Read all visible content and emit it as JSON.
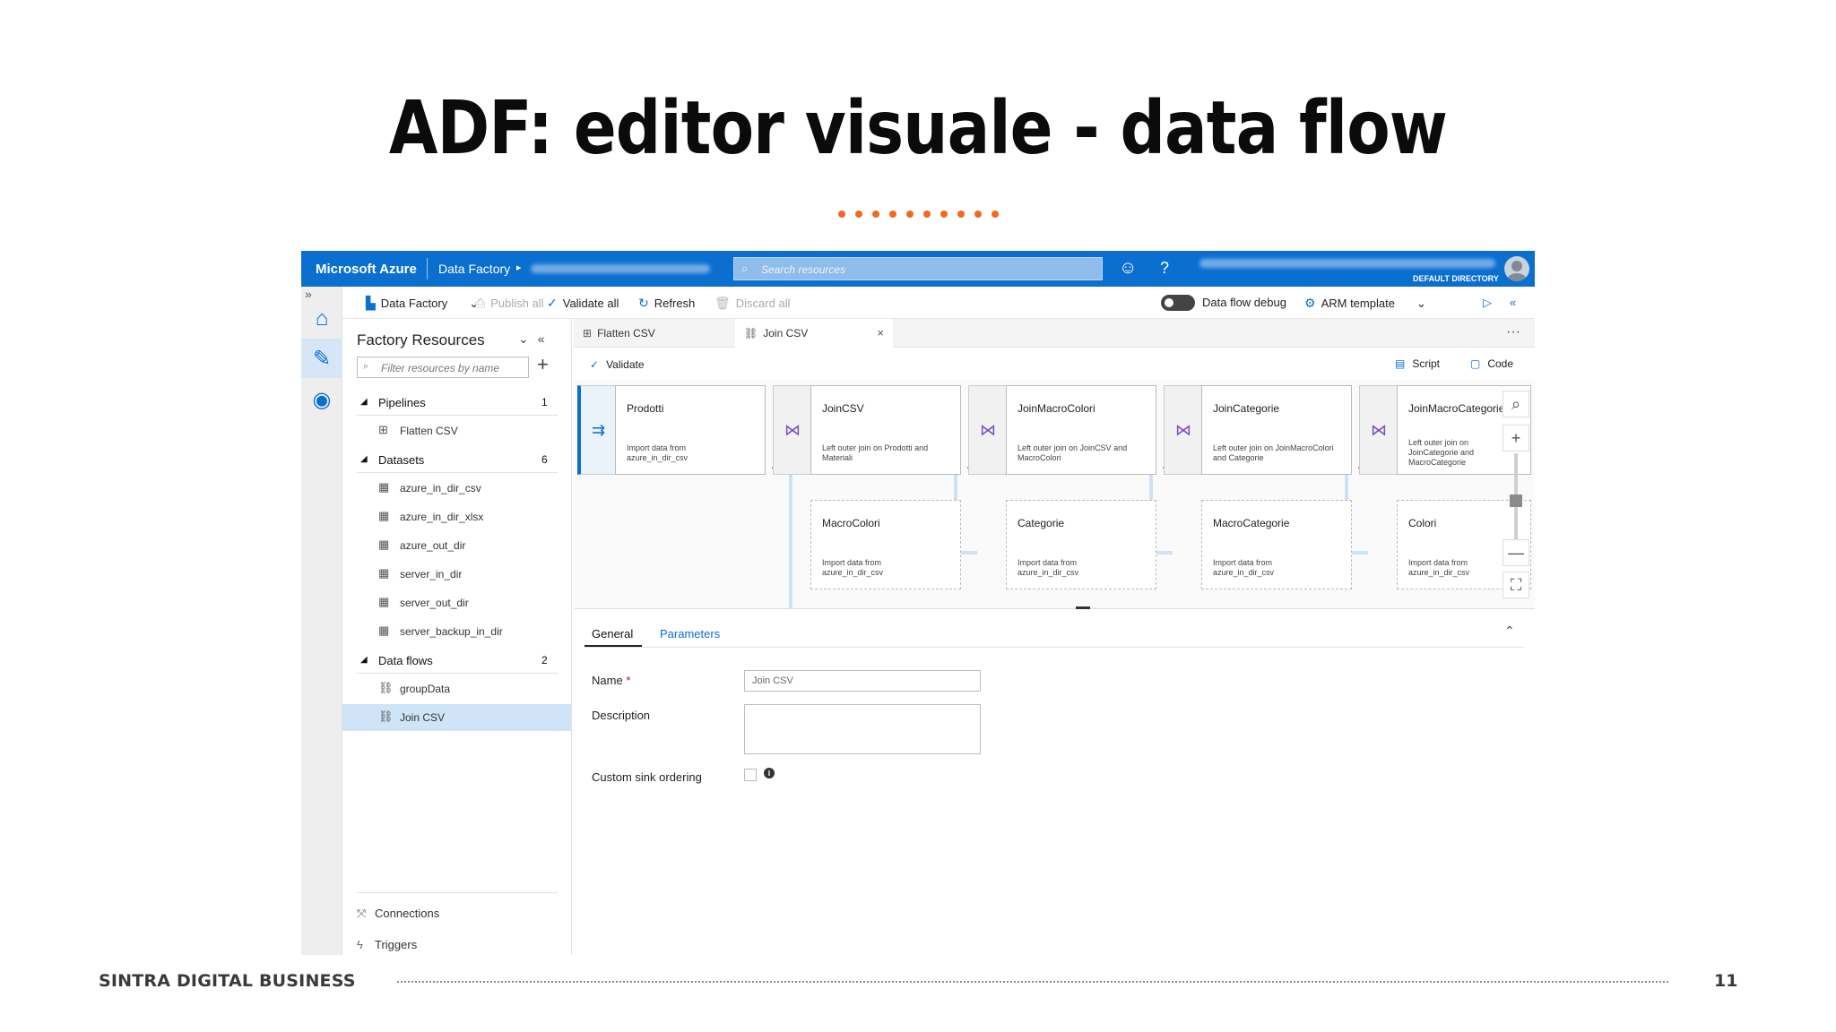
{
  "slide": {
    "title": "ADF: editor visuale - data flow",
    "footer_left": "SINTRA DIGITAL BUSINESS",
    "page_number": "11",
    "accent_color": "#ef6a1f"
  },
  "topbar": {
    "brand": "Microsoft Azure",
    "crumb": "Data Factory",
    "crumb_arrow": "▸",
    "search_placeholder": "Search resources",
    "directory": "DEFAULT DIRECTORY",
    "color": "#0b6fd0",
    "icons": {
      "search": "search-icon",
      "feedback": "smiley-icon",
      "help": "help-icon",
      "user": "avatar-icon"
    }
  },
  "rail": {
    "expand": "»",
    "items": [
      {
        "name": "home",
        "icon": "home-icon",
        "glyph": "⌂"
      },
      {
        "name": "author",
        "icon": "pencil-icon",
        "glyph": "✎"
      },
      {
        "name": "monitor",
        "icon": "monitor-icon",
        "glyph": "◉"
      }
    ]
  },
  "toolbar": {
    "factory": "Data Factory",
    "publish": "Publish all",
    "validate_all": "Validate all",
    "refresh": "Refresh",
    "discard": "Discard all",
    "debug": "Data flow debug",
    "arm": "ARM template",
    "chevron": "⌄",
    "run": "▷",
    "collapse": "«"
  },
  "resources": {
    "title": "Factory Resources",
    "controls": "⌄«",
    "filter_placeholder": "Filter resources by name",
    "add": "+",
    "pipelines": {
      "label": "Pipelines",
      "count": "1",
      "items": [
        "Flatten CSV"
      ]
    },
    "datasets": {
      "label": "Datasets",
      "count": "6",
      "items": [
        "azure_in_dir_csv",
        "azure_in_dir_xlsx",
        "azure_out_dir",
        "server_in_dir",
        "server_out_dir",
        "server_backup_in_dir"
      ]
    },
    "dataflows": {
      "label": "Data flows",
      "count": "2",
      "items": [
        "groupData",
        "Join CSV"
      ]
    },
    "footer": {
      "connections": "Connections",
      "triggers": "Triggers"
    }
  },
  "tabs": {
    "items": [
      {
        "label": "Flatten CSV",
        "icon": "pipeline-icon"
      },
      {
        "label": "Join CSV",
        "icon": "dataflow-icon"
      }
    ],
    "close": "×",
    "more": "···"
  },
  "editor": {
    "validate": "Validate",
    "script": "Script",
    "code": "Code"
  },
  "flow": {
    "top": [
      {
        "name": "Prodotti",
        "desc": "Import data from azure_in_dir_csv"
      },
      {
        "name": "JoinCSV",
        "desc": "Left outer join on Prodotti and Materiali"
      },
      {
        "name": "JoinMacroColori",
        "desc": "Left outer join on JoinCSV and MacroColori"
      },
      {
        "name": "JoinCategorie",
        "desc": "Left outer join on JoinMacroColori and Categorie"
      },
      {
        "name": "JoinMacroCategorie",
        "desc": "Left outer join on JoinCategorie and MacroCategorie"
      }
    ],
    "bottom": [
      {
        "name": "MacroColori",
        "desc": "Import data from azure_in_dir_csv"
      },
      {
        "name": "Categorie",
        "desc": "Import data from azure_in_dir_csv"
      },
      {
        "name": "MacroCategorie",
        "desc": "Import data from azure_in_dir_csv"
      },
      {
        "name": "Colori",
        "desc": "Import data from azure_in_dir_csv"
      }
    ],
    "plus": "+",
    "join_glyph": "⋈",
    "source_glyph": "⇉"
  },
  "zoom": {
    "search": "⌕",
    "in": "+",
    "out": "—",
    "fit": "⛶"
  },
  "properties": {
    "tabs": [
      "General",
      "Parameters"
    ],
    "collapse": "⌃",
    "name_label": "Name",
    "required": "*",
    "name_value": "Join CSV",
    "description_label": "Description",
    "description_value": "",
    "sink_label": "Custom sink ordering",
    "info": "i"
  }
}
